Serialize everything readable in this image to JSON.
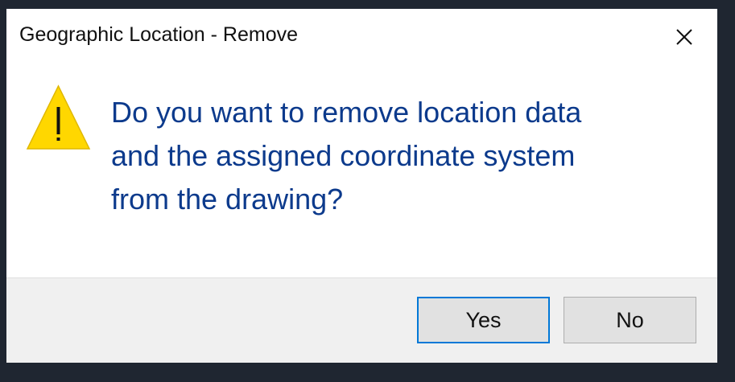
{
  "window": {
    "title": "Geographic Location - Remove"
  },
  "icons": {
    "warning": "warning-icon",
    "close": "close-icon"
  },
  "message": {
    "line1": "Do you want to remove location data",
    "line2": "and the assigned coordinate system",
    "line3": "from the drawing?"
  },
  "buttons": {
    "yes_label": "Yes",
    "no_label": "No"
  },
  "colors": {
    "message_text": "#0c3a8c",
    "warning_fill": "#ffd700",
    "focus_border": "#0078d7"
  }
}
